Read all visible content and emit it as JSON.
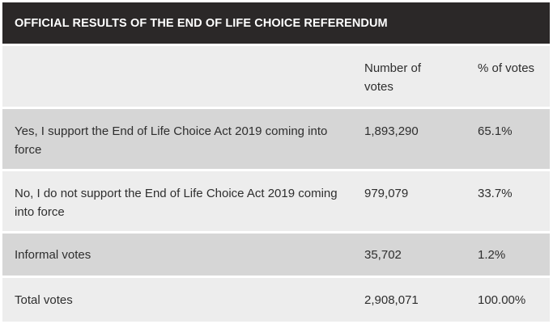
{
  "title": "OFFICIAL RESULTS OF THE END OF LIFE CHOICE REFERENDUM",
  "columns": [
    "",
    "Number of votes",
    "% of votes"
  ],
  "rows": [
    {
      "label": "Yes, I support the End of Life Choice Act 2019 coming into force",
      "votes": "1,893,290",
      "percent": "65.1%"
    },
    {
      "label": "No, I do not support the End of Life Choice Act 2019 coming into force",
      "votes": "979,079",
      "percent": "33.7%"
    },
    {
      "label": "Informal votes",
      "votes": "35,702",
      "percent": "1.2%"
    },
    {
      "label": "Total votes",
      "votes": "2,908,071",
      "percent": "100.00%"
    }
  ],
  "colors": {
    "title_background": "#2b2828",
    "row_light": "#ededed",
    "row_dark": "#d6d6d6",
    "text": "#2e2e2e"
  }
}
